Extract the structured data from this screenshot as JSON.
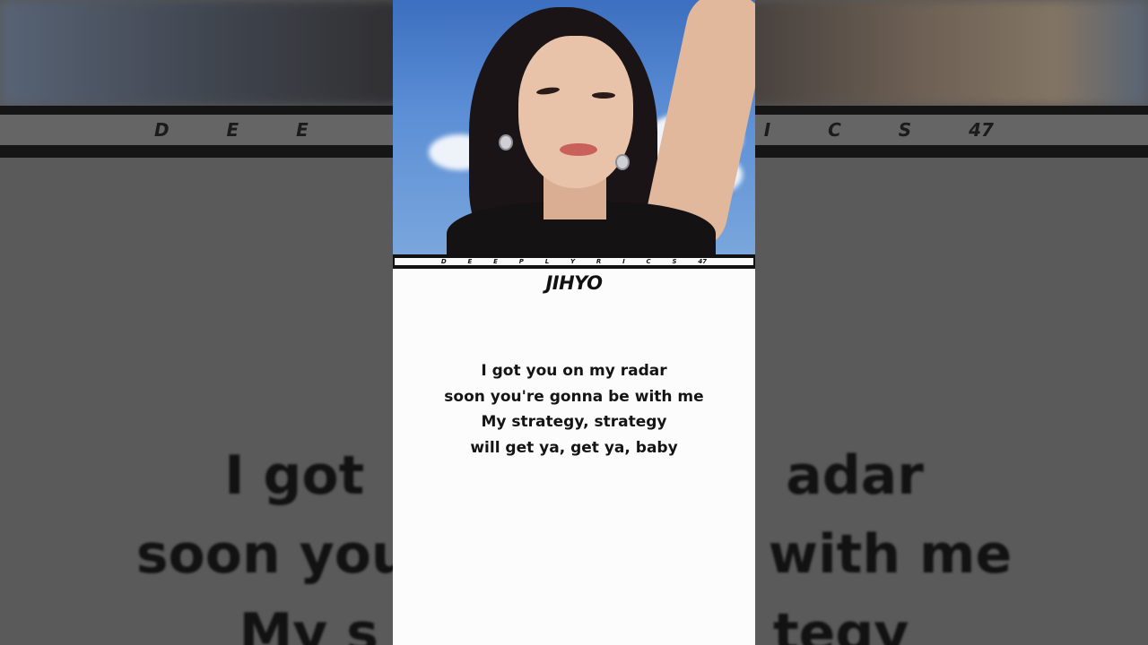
{
  "channel": {
    "band_letters_large": [
      "D",
      "E",
      "E",
      "I",
      "C",
      "S",
      "47"
    ],
    "band_letters_small": [
      "D",
      "E",
      "E",
      "P",
      "L",
      "Y",
      "R",
      "I",
      "C",
      "S",
      "47"
    ]
  },
  "singer": "JIHYO",
  "lyrics": [
    "I got you on my radar",
    "soon you're gonna be with me",
    "My strategy, strategy",
    "will get ya, get ya, baby"
  ],
  "background_lyrics": [
    {
      "left": "I got",
      "right": "adar"
    },
    {
      "left": "soon you",
      "right": "with me"
    },
    {
      "left": "My s",
      "right": "tegy"
    }
  ]
}
